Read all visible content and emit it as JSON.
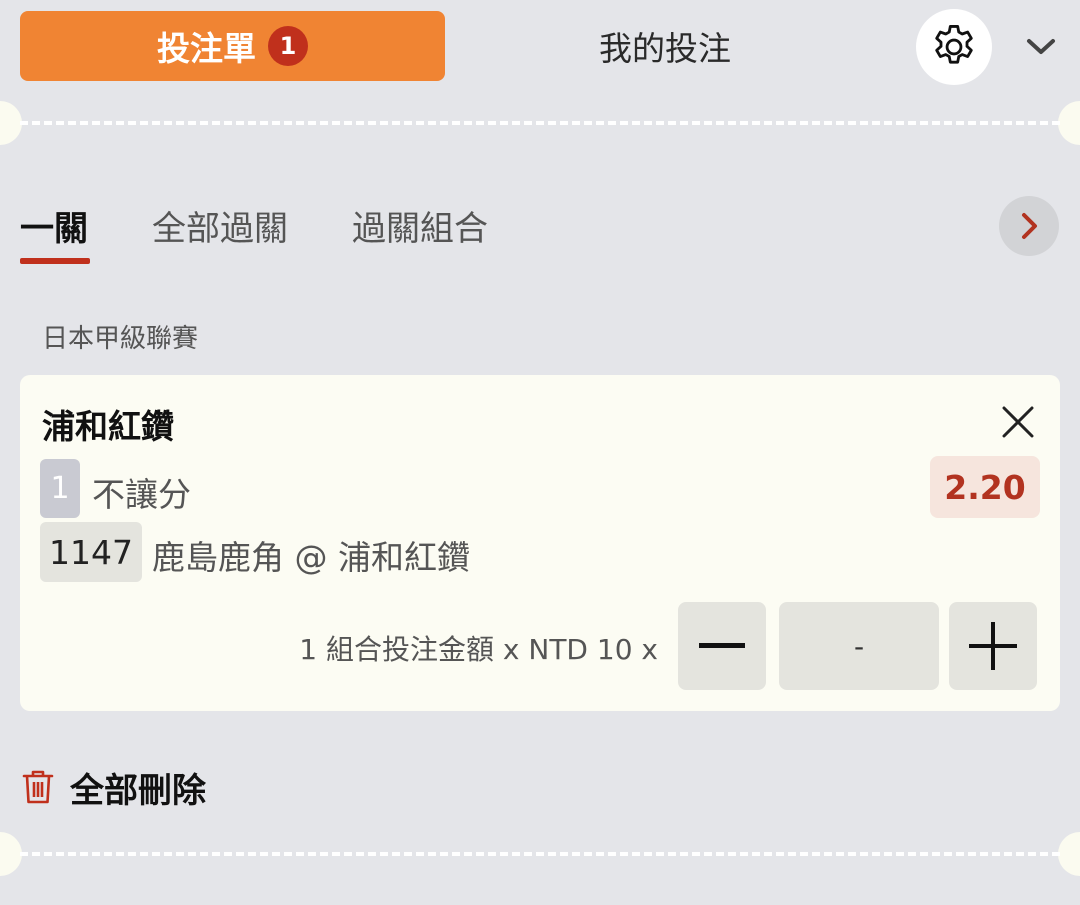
{
  "header": {
    "betslip_label": "投注單",
    "betslip_count": "1",
    "mybets_label": "我的投注",
    "settings_icon": "gear-icon",
    "collapse_icon": "chevron-down-icon"
  },
  "bet_types": {
    "tabs": [
      {
        "label": "一關",
        "active": true
      },
      {
        "label": "全部過關",
        "active": false
      },
      {
        "label": "過關組合",
        "active": false
      }
    ],
    "next_icon": "chevron-right-icon"
  },
  "league": "日本甲級聯賽",
  "bet": {
    "team": "浦和紅鑽",
    "selection_code": "1",
    "market": "不讓分",
    "odds": "2.20",
    "match_code": "1147",
    "match": "鹿島鹿角 @ 浦和紅鑽",
    "stake_label": "1 組合投注金額 x NTD 10 x",
    "stake_value": "-"
  },
  "footer": {
    "delete_all_label": "全部刪除",
    "delete_icon": "trash-icon"
  },
  "colors": {
    "accent": "#f08433",
    "badge": "#c0301c",
    "odds_text": "#b23320",
    "background": "#e4e5e9",
    "card": "#fcfcf3"
  }
}
